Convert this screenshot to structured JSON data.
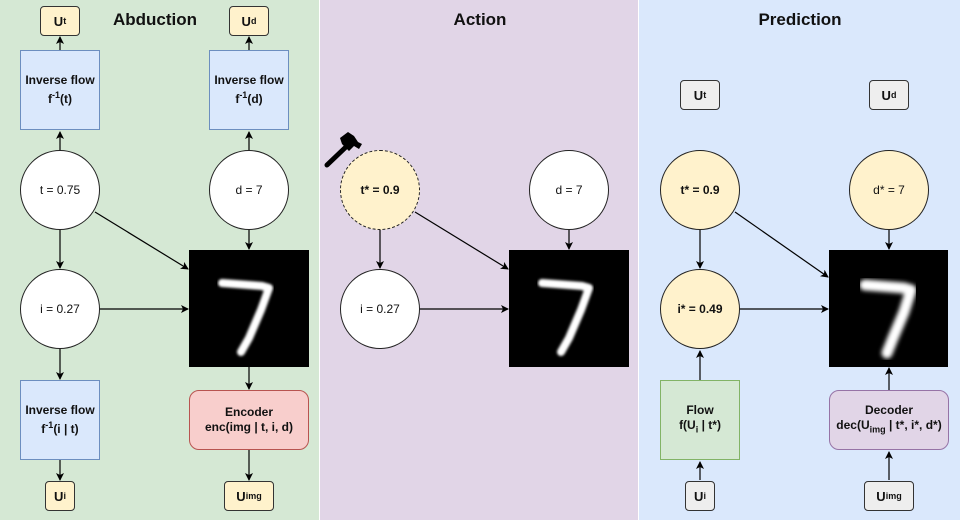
{
  "panels": {
    "abduction": {
      "title": "Abduction",
      "color": "#d5e8d4",
      "noise_t": {
        "base": "U",
        "sub": "t"
      },
      "noise_d": {
        "base": "U",
        "sub": "d"
      },
      "noise_i": {
        "base": "U",
        "sub": "i"
      },
      "noise_img": {
        "base": "U",
        "sub": "img"
      },
      "inv_flow_t": {
        "line1": "Inverse flow",
        "fn": "f",
        "sup": "-1",
        "arg": "(t)"
      },
      "inv_flow_d": {
        "line1": "Inverse flow",
        "fn": "f",
        "sup": "-1",
        "arg": "(d)"
      },
      "inv_flow_i": {
        "line1": "Inverse flow",
        "fn": "f",
        "sup": "-1",
        "arg": "(i | t)"
      },
      "node_t": "t = 0.75",
      "node_d": "d = 7",
      "node_i": "i = 0.27",
      "image_digit": "7",
      "encoder": {
        "line1": "Encoder",
        "line2": "enc(img | t, i, d)"
      }
    },
    "action": {
      "title": "Action",
      "color": "#e1d5e7",
      "intervention_icon": "hammer-icon",
      "node_t": "t* = 0.9",
      "node_d": "d = 7",
      "node_i": "i = 0.27",
      "image_digit": "7"
    },
    "prediction": {
      "title": "Prediction",
      "color": "#dae8fc",
      "noise_t": {
        "base": "U",
        "sub": "t"
      },
      "noise_d": {
        "base": "U",
        "sub": "d"
      },
      "noise_i": {
        "base": "U",
        "sub": "i"
      },
      "noise_img": {
        "base": "U",
        "sub": "img"
      },
      "node_t": "t* = 0.9",
      "node_d": "d* = 7",
      "node_i": "i* = 0.49",
      "image_digit": "7",
      "flow": {
        "line1": "Flow",
        "pre": "f(U",
        "sub": "i",
        "post": " | t*)"
      },
      "decoder": {
        "line1": "Decoder",
        "pre": "dec(U",
        "sub": "img",
        "post": " | t*, i*, d*)"
      }
    }
  }
}
